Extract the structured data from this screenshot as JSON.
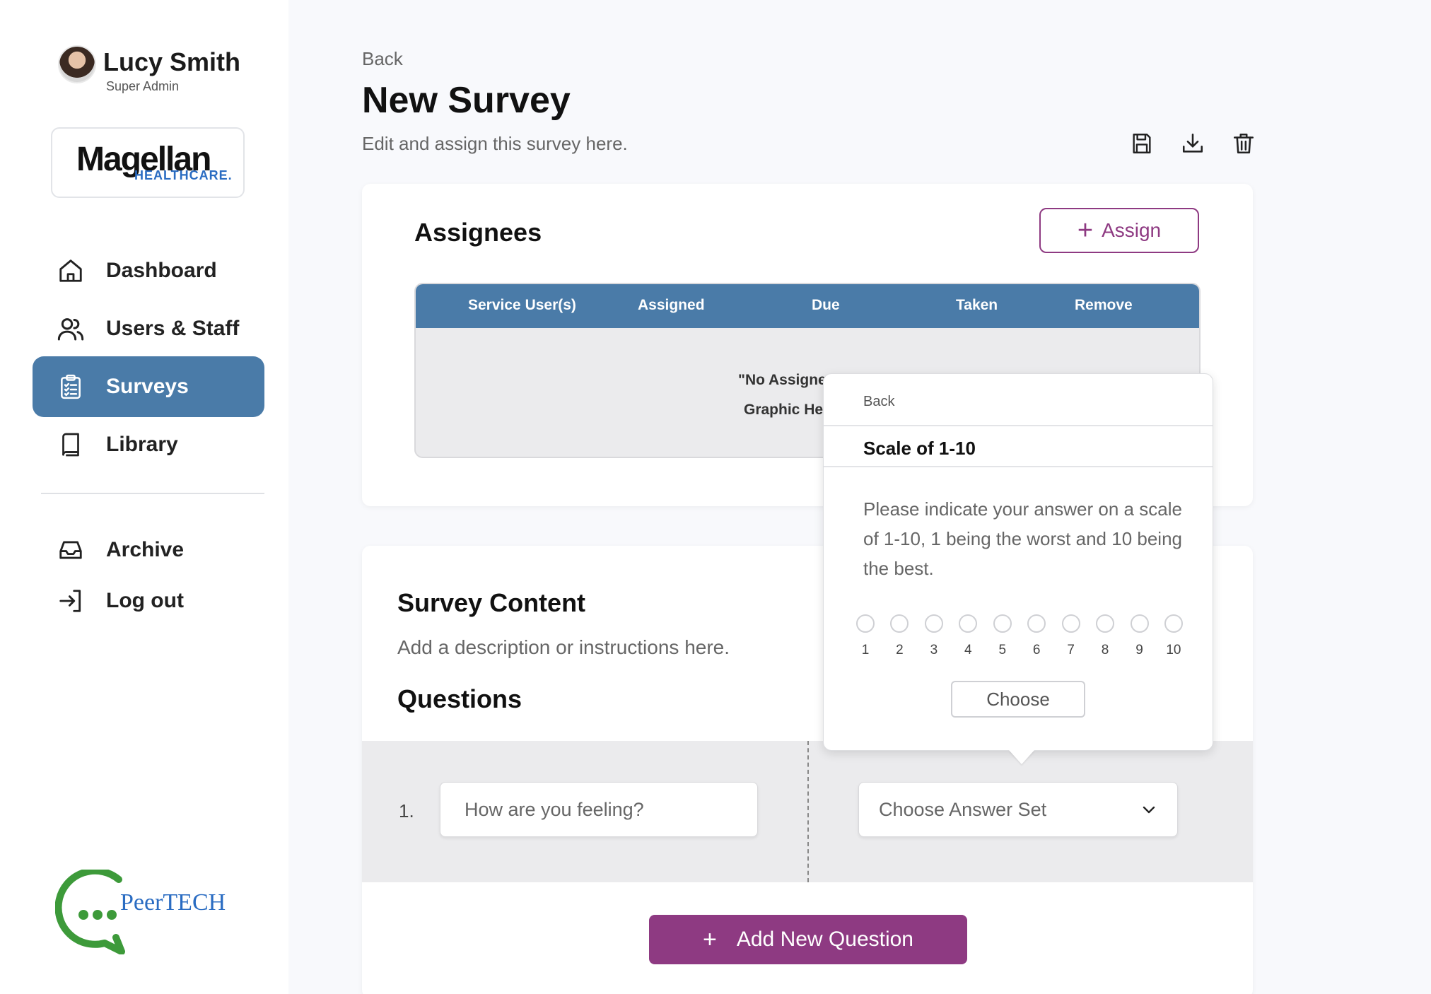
{
  "user": {
    "name": "Lucy Smith",
    "role": "Super Admin"
  },
  "org": {
    "logo_main": "Magellan",
    "logo_sub": "HEALTHCARE."
  },
  "nav": {
    "items": [
      {
        "label": "Dashboard",
        "icon": "home-icon"
      },
      {
        "label": "Users & Staff",
        "icon": "users-icon"
      },
      {
        "label": "Surveys",
        "icon": "clipboard-icon",
        "active": true
      },
      {
        "label": "Library",
        "icon": "book-icon"
      }
    ],
    "secondary": [
      {
        "label": "Archive",
        "icon": "inbox-icon"
      },
      {
        "label": "Log out",
        "icon": "logout-icon"
      }
    ]
  },
  "brand": {
    "name": "PeerTECH"
  },
  "page": {
    "back": "Back",
    "title": "New Survey",
    "subtitle": "Edit and assign this survey here."
  },
  "toolbar": {
    "icons": [
      "save-icon",
      "download-icon",
      "trash-icon"
    ]
  },
  "assignees": {
    "title": "Assignees",
    "assign_label": "Assign",
    "columns": [
      "Service User(s)",
      "Assigned",
      "Due",
      "Taken",
      "Remove"
    ],
    "empty_line1": "\"No Assignee",
    "empty_line2": "Graphic Her"
  },
  "survey_content": {
    "title": "Survey Content",
    "description": "Add a description or instructions here.",
    "questions_title": "Questions",
    "questions": [
      {
        "number": "1.",
        "placeholder": "How are you feeling?",
        "answer_set_placeholder": "Choose Answer Set"
      }
    ],
    "add_question_label": "Add New Question"
  },
  "popover": {
    "back": "Back",
    "title": "Scale of 1-10",
    "description": "Please indicate your answer on a scale of 1-10, 1 being the worst and 10 being the best.",
    "scale": [
      "1",
      "2",
      "3",
      "4",
      "5",
      "6",
      "7",
      "8",
      "9",
      "10"
    ],
    "choose_label": "Choose"
  },
  "colors": {
    "primary_blue": "#4a7ba8",
    "accent_purple": "#8e3a82",
    "brand_green": "#3d9a3a",
    "brand_blue": "#2a6cc2"
  }
}
